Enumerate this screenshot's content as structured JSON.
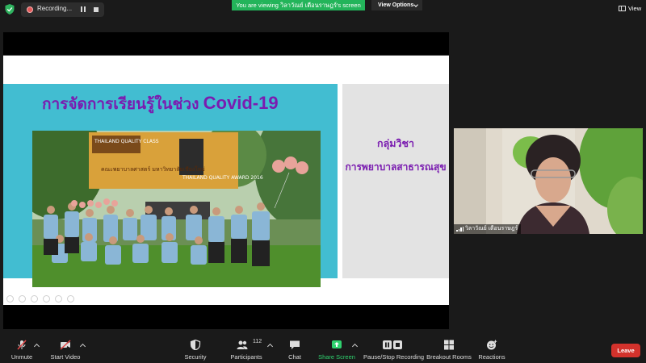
{
  "topbar": {
    "recording_label": "Recording...",
    "viewing_banner": "You are viewing วิลาวัณย์ เตือนราษฎร์'s screen",
    "view_options_label": "View Options",
    "view_label": "View"
  },
  "slide": {
    "title_thai": "การจัดการเรียนรู้ในช่วง",
    "title_en": "Covid-19",
    "side_line1": "กลุ่มวิชา",
    "side_line2": "การพยาบาลสาธารณสุข",
    "banner_text_1": "THAILAND QUALITY CLASS",
    "banner_text_2": "THAILAND QUALITY AWARD 2016",
    "banner_text_3": "คณะพยาบาลศาสตร์ มหาวิทยาลัยเชียงใหม่"
  },
  "video": {
    "participant_name": "วิลาวัณย์ เตือนราษฎร์"
  },
  "toolbar": {
    "unmute": "Unmute",
    "start_video": "Start Video",
    "security": "Security",
    "participants": "Participants",
    "participants_count": "112",
    "chat": "Chat",
    "share_screen": "Share Screen",
    "pause_stop_recording": "Pause/Stop Recording",
    "breakout_rooms": "Breakout Rooms",
    "reactions": "Reactions",
    "leave": "Leave"
  },
  "colors": {
    "share_green": "#23b45a",
    "slide_purple": "#7a1cb0",
    "slide_blue": "#42bdd1",
    "leave_red": "#d3322c"
  }
}
